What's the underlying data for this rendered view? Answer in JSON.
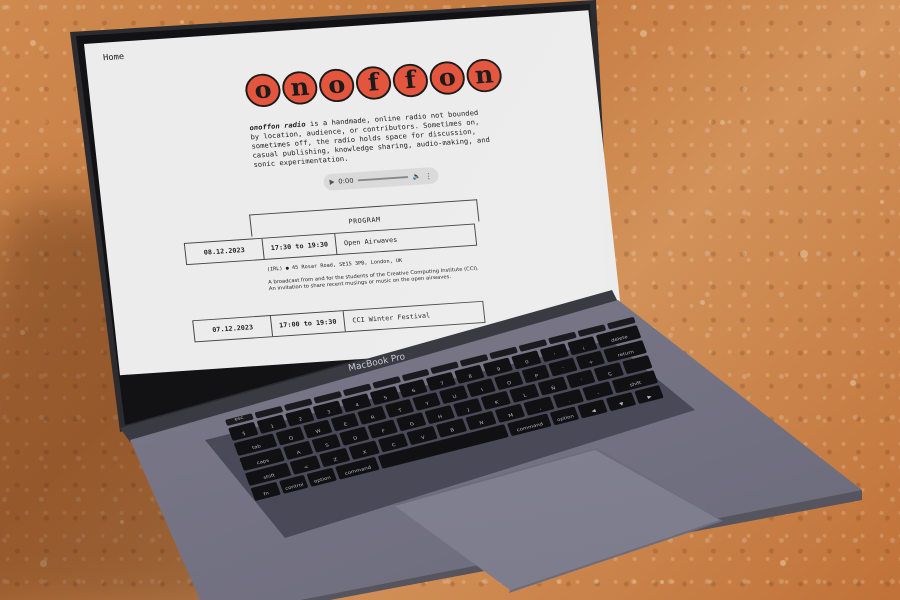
{
  "page": {
    "nav": {
      "home": "Home"
    },
    "logo_letters": [
      "o",
      "n",
      "o",
      "f",
      "f",
      "o",
      "n"
    ],
    "intro": {
      "name": "onoffon radio",
      "text": " is a handmade, online radio not bounded by location, audience, or contributors. Sometimes on, sometimes off, the radio holds space for discussion, casual publishing, knowledge sharing, audio-making, and sonic experimentation."
    },
    "player": {
      "time": "0:00"
    },
    "program_heading": "PROGRAM",
    "entries": [
      {
        "date": "08.12.2023",
        "time": "17:30 to 19:30",
        "title": "Open Airwaves",
        "address": "(IRL) ● 45 Rosar Road, SE15 3PB, London, UK",
        "description": "A broadcast from and for the students of the Creative Computing Institute (CCI). An invitation to share recent musings or music on the open airwaves."
      },
      {
        "date": "07.12.2023",
        "time": "17:00 to 19:30",
        "title": "CCI Winter Festival"
      }
    ]
  },
  "laptop": {
    "brand": "MacBook Pro",
    "key_rows": [
      [
        "esc",
        "",
        "",
        "",
        "",
        "",
        "",
        "",
        "",
        "",
        "",
        "",
        "",
        ""
      ],
      [
        "§",
        "1",
        "2",
        "3",
        "4",
        "5",
        "6",
        "7",
        "8",
        "9",
        "0",
        "'",
        "¡",
        "delete"
      ],
      [
        "tab",
        "Q",
        "W",
        "E",
        "R",
        "T",
        "Y",
        "U",
        "I",
        "O",
        "P",
        "`",
        "+",
        "return"
      ],
      [
        "caps",
        "A",
        "S",
        "D",
        "F",
        "G",
        "H",
        "J",
        "K",
        "L",
        "Ñ",
        "´",
        "Ç",
        ""
      ],
      [
        "shift",
        "<",
        "Z",
        "X",
        "C",
        "V",
        "B",
        "N",
        "M",
        ",",
        ".",
        "-",
        "shift"
      ],
      [
        "fn",
        "control",
        "option",
        "command",
        "",
        "command",
        "option",
        "◀",
        "▼",
        "▶"
      ]
    ]
  }
}
